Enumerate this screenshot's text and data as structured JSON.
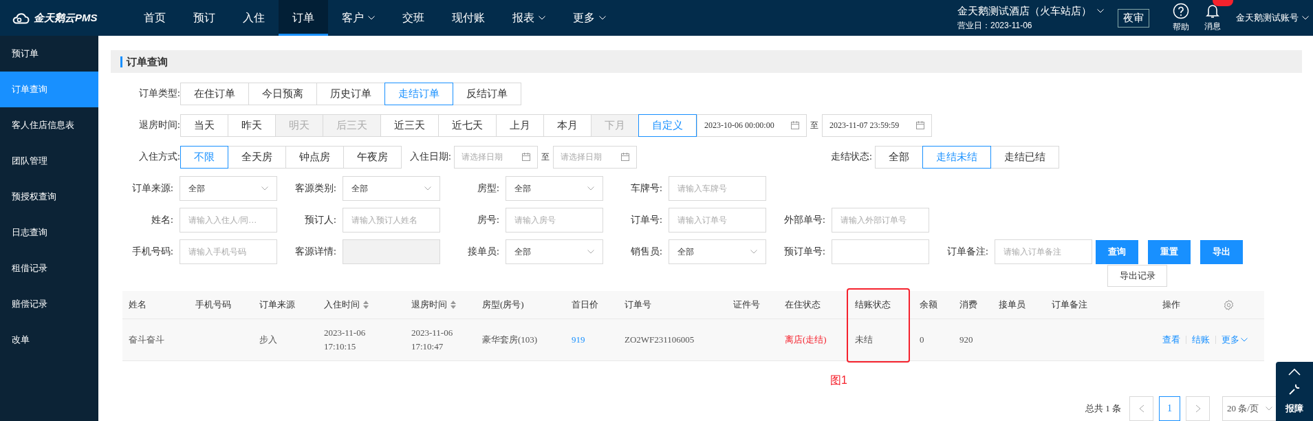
{
  "header": {
    "logo_text": "金天鹅云PMS",
    "nav": [
      {
        "label": "首页",
        "selected": false,
        "dropdown": false
      },
      {
        "label": "预订",
        "selected": false,
        "dropdown": false
      },
      {
        "label": "入住",
        "selected": false,
        "dropdown": false
      },
      {
        "label": "订单",
        "selected": true,
        "dropdown": false
      },
      {
        "label": "客户",
        "selected": false,
        "dropdown": true
      },
      {
        "label": "交班",
        "selected": false,
        "dropdown": false
      },
      {
        "label": "现付账",
        "selected": false,
        "dropdown": false
      },
      {
        "label": "报表",
        "selected": false,
        "dropdown": true
      },
      {
        "label": "更多",
        "selected": false,
        "dropdown": true
      }
    ],
    "hotel": "金天鹅测试酒店（火车站店）",
    "business_day": "营业日：2023-11-06",
    "night_audit": "夜审",
    "help": "帮助",
    "messages": "消息",
    "account": "金天鹅测试账号"
  },
  "sidebar": {
    "items": [
      {
        "label": "预订单",
        "selected": false
      },
      {
        "label": "订单查询",
        "selected": true
      },
      {
        "label": "客人住店信息表",
        "selected": false
      },
      {
        "label": "团队管理",
        "selected": false
      },
      {
        "label": "预授权查询",
        "selected": false
      },
      {
        "label": "日志查询",
        "selected": false
      },
      {
        "label": "租借记录",
        "selected": false
      },
      {
        "label": "赔偿记录",
        "selected": false
      },
      {
        "label": "改单",
        "selected": false
      }
    ]
  },
  "panel": {
    "title": "订单查询"
  },
  "filters": {
    "order_type": {
      "label": "订单类型:",
      "options": [
        {
          "label": "在住订单",
          "selected": false,
          "disabled": false
        },
        {
          "label": "今日预离",
          "selected": false,
          "disabled": false
        },
        {
          "label": "历史订单",
          "selected": false,
          "disabled": false
        },
        {
          "label": "走结订单",
          "selected": true,
          "disabled": false
        },
        {
          "label": "反结订单",
          "selected": false,
          "disabled": false
        }
      ]
    },
    "checkout_time": {
      "label": "退房时间:",
      "options": [
        {
          "label": "当天",
          "selected": false,
          "disabled": false
        },
        {
          "label": "昨天",
          "selected": false,
          "disabled": false
        },
        {
          "label": "明天",
          "selected": false,
          "disabled": true
        },
        {
          "label": "后三天",
          "selected": false,
          "disabled": true
        },
        {
          "label": "近三天",
          "selected": false,
          "disabled": false
        },
        {
          "label": "近七天",
          "selected": false,
          "disabled": false
        },
        {
          "label": "上月",
          "selected": false,
          "disabled": false
        },
        {
          "label": "本月",
          "selected": false,
          "disabled": false
        },
        {
          "label": "下月",
          "selected": false,
          "disabled": true
        },
        {
          "label": "自定义",
          "selected": true,
          "disabled": false
        }
      ],
      "from": "2023-10-06 00:00:00",
      "separator": "至",
      "to": "2023-11-07 23:59:59"
    },
    "checkin_method": {
      "label": "入住方式:",
      "options": [
        {
          "label": "不限",
          "selected": true,
          "disabled": false
        },
        {
          "label": "全天房",
          "selected": false,
          "disabled": false
        },
        {
          "label": "钟点房",
          "selected": false,
          "disabled": false
        },
        {
          "label": "午夜房",
          "selected": false,
          "disabled": false
        }
      ]
    },
    "checkin_date": {
      "label": "入住日期:",
      "from_placeholder": "请选择日期",
      "separator": "至",
      "to_placeholder": "请选择日期"
    },
    "settle_status": {
      "label": "走结状态:",
      "options": [
        {
          "label": "全部",
          "selected": false,
          "disabled": false
        },
        {
          "label": "走结未结",
          "selected": true,
          "disabled": false
        },
        {
          "label": "走结已结",
          "selected": false,
          "disabled": false
        }
      ]
    },
    "field_rows": [
      [
        {
          "label": "订单来源:",
          "kind": "select",
          "value": "全部"
        },
        {
          "label": "客源类别:",
          "kind": "select",
          "value": "全部"
        },
        {
          "label": "房型:",
          "kind": "select",
          "value": "全部"
        },
        {
          "label": "车牌号:",
          "kind": "input",
          "placeholder": "请输入车牌号"
        }
      ],
      [
        {
          "label": "姓名:",
          "kind": "input",
          "placeholder": "请输入入住人/同…"
        },
        {
          "label": "预订人:",
          "kind": "input",
          "placeholder": "请输入预订人姓名"
        },
        {
          "label": "房号:",
          "kind": "input",
          "placeholder": "请输入房号"
        },
        {
          "label": "订单号:",
          "kind": "input",
          "placeholder": "请输入订单号"
        },
        {
          "label": "外部单号:",
          "kind": "input",
          "placeholder": "请输入外部订单号"
        }
      ],
      [
        {
          "label": "手机号码:",
          "kind": "input",
          "placeholder": "请输入手机号码"
        },
        {
          "label": "客源详情:",
          "kind": "disabled"
        },
        {
          "label": "接单员:",
          "kind": "select",
          "value": "全部"
        },
        {
          "label": "销售员:",
          "kind": "select",
          "value": "全部"
        },
        {
          "label": "预订单号:",
          "kind": "input"
        },
        {
          "label": "订单备注:",
          "kind": "input",
          "placeholder": "请输入订单备注"
        }
      ]
    ],
    "buttons": [
      "查询",
      "重置",
      "导出"
    ],
    "export_records": "导出记录"
  },
  "table": {
    "columns": [
      {
        "label": "姓名",
        "sortable": false
      },
      {
        "label": "手机号码",
        "sortable": false
      },
      {
        "label": "订单来源",
        "sortable": false
      },
      {
        "label": "入住时间",
        "sortable": true
      },
      {
        "label": "退房时间",
        "sortable": true
      },
      {
        "label": "房型(房号)",
        "sortable": false
      },
      {
        "label": "首日价",
        "sortable": false
      },
      {
        "label": "订单号",
        "sortable": false
      },
      {
        "label": "证件号",
        "sortable": false
      },
      {
        "label": "在住状态",
        "sortable": false
      },
      {
        "label": "结账状态",
        "sortable": false
      },
      {
        "label": "余额",
        "sortable": false
      },
      {
        "label": "消费",
        "sortable": false
      },
      {
        "label": "接单员",
        "sortable": false
      },
      {
        "label": "订单备注",
        "sortable": false
      },
      {
        "label": "操作",
        "sortable": false
      }
    ],
    "rows": [
      {
        "name": "奋斗奋斗",
        "source": "步入",
        "checkin": "2023-11-06 17:10:15",
        "checkout": "2023-11-06 17:10:47",
        "room": "豪华套房(103)",
        "first_price": "919",
        "order_no": "ZO2WF231106005",
        "stay_status": "离店(走结)",
        "settle_status": "未结",
        "balance": "0",
        "consumption": "920",
        "actions": [
          "查看",
          "结账",
          "更多"
        ]
      }
    ]
  },
  "annotation": {
    "label": "图1"
  },
  "pagination": {
    "total": "总共 1 条",
    "pages": [
      {
        "label": "1",
        "selected": true
      }
    ],
    "page_size": "20 条/页"
  },
  "float_widget": {
    "label": "报障"
  }
}
